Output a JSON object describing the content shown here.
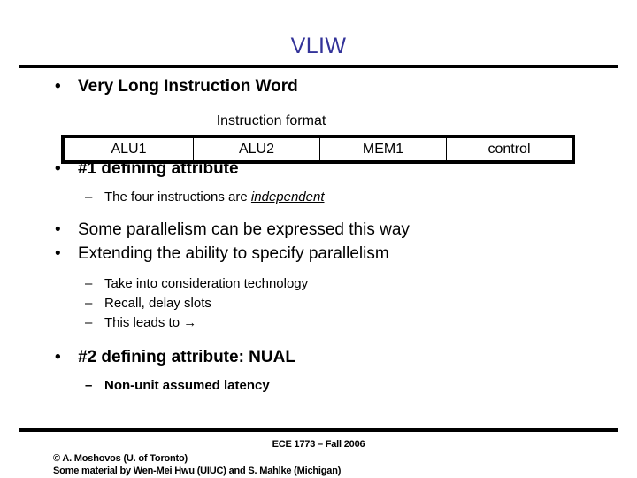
{
  "slide": {
    "title": "VLIW",
    "title_color": "#333399",
    "background_color": "#ffffff",
    "text_color": "#000000"
  },
  "bullets": {
    "b1": "Very Long Instruction Word",
    "b2": "#1 defining attribute",
    "b2_sub1_pre": "The four instructions are ",
    "b2_sub1_emph": "independent",
    "b3": "Some parallelism can be expressed this way",
    "b4": "Extending the ability to specify parallelism",
    "b4_sub1": "Take into consideration technology",
    "b4_sub2": "Recall, delay slots",
    "b4_sub3": "This leads to →",
    "b5": "#2 defining attribute: NUAL",
    "b5_sub1": "Non-unit assumed latency",
    "bullet_glyph": "•",
    "dash_glyph": "–"
  },
  "instruction_format": {
    "caption": "Instruction format",
    "cells": [
      "ALU1",
      "ALU2",
      "MEM1",
      "control"
    ]
  },
  "footer": {
    "course": "ECE 1773 – Fall 2006",
    "copyright": "© A. Moshovos (U. of Toronto)",
    "credits": "Some material by Wen-Mei Hwu (UIUC) and S. Mahlke (Michigan)"
  }
}
